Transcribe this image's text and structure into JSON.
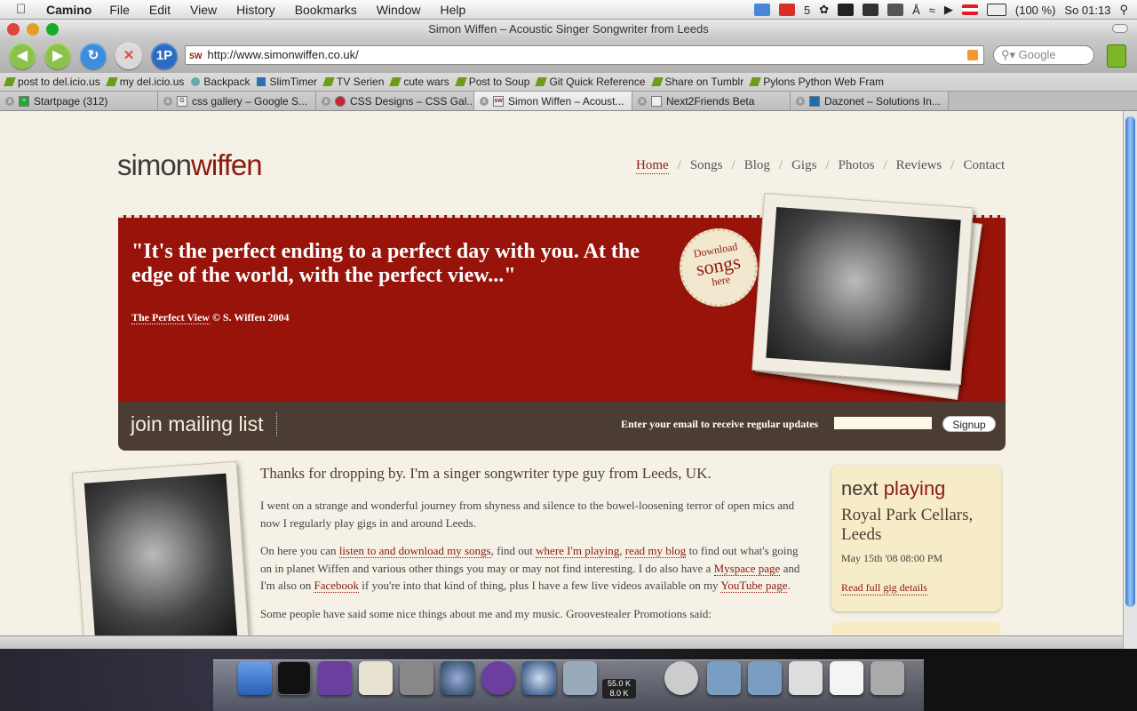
{
  "menubar": {
    "app": "Camino",
    "items": [
      "File",
      "Edit",
      "View",
      "History",
      "Bookmarks",
      "Window",
      "Help"
    ],
    "mail_count": "5",
    "battery": "(100 %)",
    "clock": "So 01:13"
  },
  "window": {
    "title": "Simon Wiffen – Acoustic Singer Songwriter from Leeds"
  },
  "toolbar": {
    "url": "http://www.simonwiffen.co.uk/",
    "site_favicon_text": "SW",
    "search_placeholder": "Google",
    "onepassword_label": "1P"
  },
  "bookmarks": [
    "post to del.icio.us",
    "my del.icio.us",
    "Backpack",
    "SlimTimer",
    "TV Serien",
    "cute wars",
    "Post to Soup",
    "Git Quick Reference",
    "Share on Tumblr",
    "Pylons Python Web Fram"
  ],
  "tabs": [
    {
      "label": "Startpage (312)"
    },
    {
      "label": "css gallery – Google S..."
    },
    {
      "label": "CSS Designs – CSS Gal..."
    },
    {
      "label": "Simon Wiffen – Acoust..."
    },
    {
      "label": "Next2Friends Beta"
    },
    {
      "label": "Dazonet – Solutions In..."
    }
  ],
  "site": {
    "logo_a": "simon",
    "logo_b": "wiffen",
    "nav": [
      "Home",
      "Songs",
      "Blog",
      "Gigs",
      "Photos",
      "Reviews",
      "Contact"
    ],
    "nav_sep": "/",
    "hero_quote": "\"It's the perfect ending to a perfect day with you. At the edge of the world, with the perfect view...\"",
    "hero_song": "The Perfect View",
    "hero_copy": "© S. Wiffen 2004",
    "badge": {
      "line1": "Download",
      "line2": "songs",
      "line3": "here"
    },
    "mailing": {
      "title": "join mailing list",
      "prompt": "Enter your email to receive regular updates",
      "button": "Signup"
    },
    "intro": "Thanks for dropping by. I'm a singer songwriter type guy from Leeds, UK.",
    "p1": "I went on a strange and wonderful journey from shyness and silence to the bowel-loosening terror of open mics and now I regularly play gigs in and around Leeds.",
    "p2": {
      "t1": "On here you can ",
      "l1": "listen to and download my songs",
      "t2": ", find out ",
      "l2": "where I'm playing",
      "t3": ", ",
      "l3": "read my blog",
      "t4": " to find out what's going on in planet Wiffen and various other things you may or may not find interesting. I do also have a ",
      "l4": "Myspace page",
      "t5": " and I'm also on ",
      "l5": "Facebook",
      "t6": " if you're into that kind of thing, plus I have a few live videos available on my ",
      "l6": "YouTube page",
      "t7": "."
    },
    "p3": "Some people have said some nice things about me and my music. Groovestealer Promotions said:",
    "next": {
      "title_a": "next ",
      "title_b": "playing",
      "venue": "Royal Park Cellars, Leeds",
      "date": "May 15th '08 08:00 PM",
      "link": "Read full gig details"
    }
  },
  "dock": {
    "net_up": "55.0 K",
    "net_down": "8.0 K"
  },
  "colors": {
    "brand_red": "#8b1a10",
    "hero_red": "#98140a",
    "mail_bar": "#4b3d33",
    "page_bg": "#f5f1e6"
  }
}
